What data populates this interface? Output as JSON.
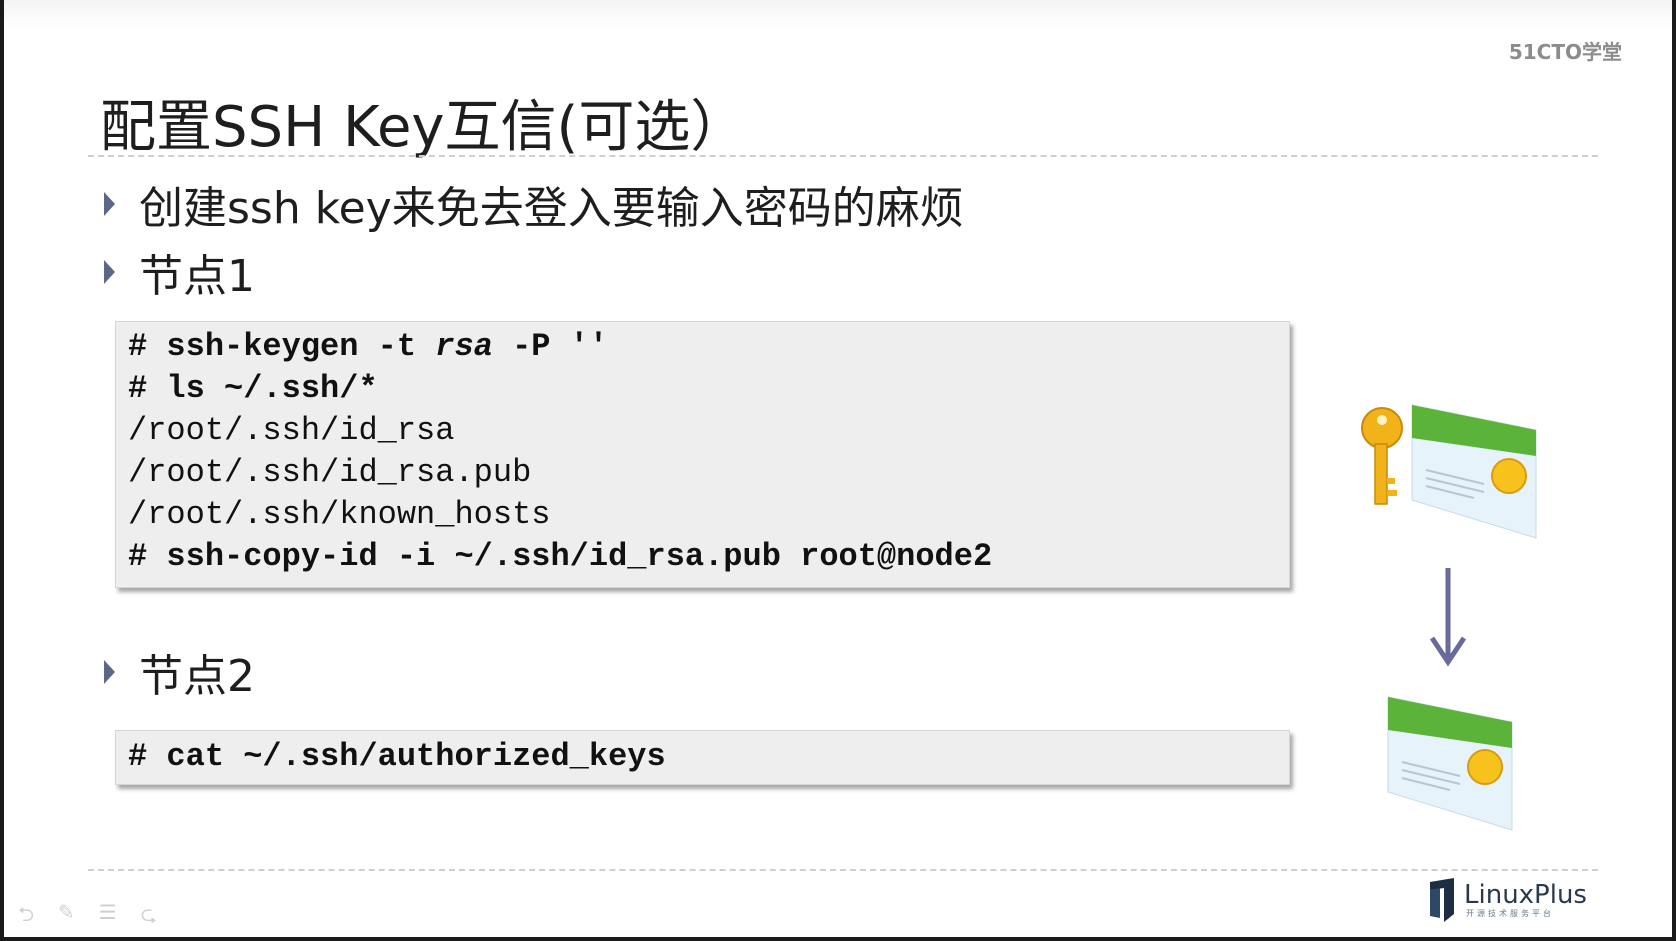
{
  "watermark": "51CTO学堂",
  "slide": {
    "title": "配置SSH Key互信(可选）",
    "bullets": [
      "创建ssh key来免去登入要输入密码的麻烦",
      "节点1",
      "节点2"
    ],
    "code_node1": {
      "line1_prefix": "# ssh-keygen -t ",
      "line1_italic": "rsa",
      "line1_suffix": " -P ''",
      "line2": "# ls ~/.ssh/*",
      "line3": "/root/.ssh/id_rsa",
      "line4": "/root/.ssh/id_rsa.pub",
      "line5": "/root/.ssh/known_hosts",
      "line6": "# ssh-copy-id -i ~/.ssh/id_rsa.pub root@node2"
    },
    "code_node2": {
      "line1": "# cat ~/.ssh/authorized_keys"
    }
  },
  "illustration": {
    "icons": [
      "key-icon",
      "certificate-icon",
      "arrow-down-icon",
      "certificate-icon"
    ],
    "colors": {
      "key": "#f2b21a",
      "card_green": "#5cb33a",
      "card_body": "#e6f3fb",
      "seal": "#f7c21b",
      "arrow": "#6a6a9a"
    }
  },
  "brand": {
    "name": "LinuxPlus",
    "subtitle": "开源技术服务平台"
  },
  "player_toolbar": {
    "icons": [
      "back-icon",
      "pen-icon",
      "menu-icon",
      "forward-icon"
    ]
  }
}
